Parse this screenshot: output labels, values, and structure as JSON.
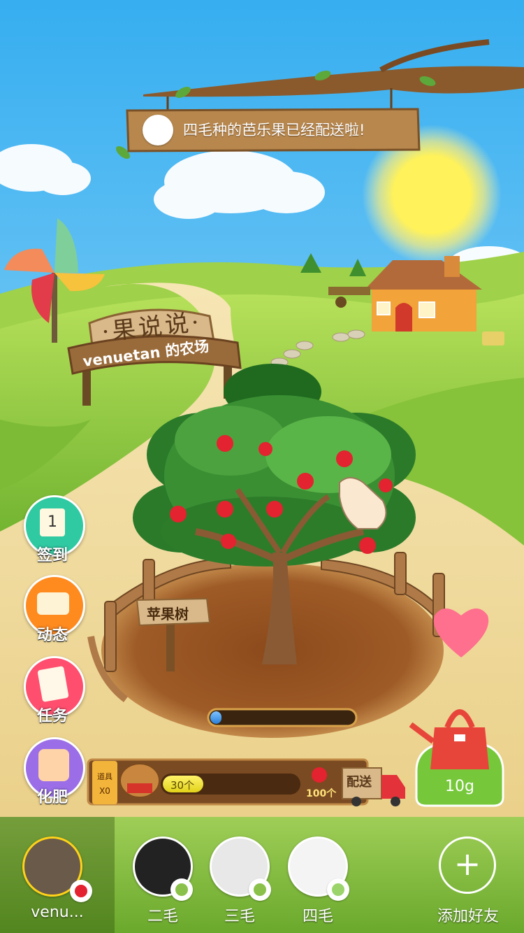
{
  "banner": {
    "message": "四毛种的芭乐果已经配送啦!"
  },
  "farm_sign": {
    "title": "·果说说·",
    "owner_line": "venuetan 的农场"
  },
  "tree": {
    "label": "苹果树",
    "growth_progress": 0.08
  },
  "side_buttons": [
    {
      "label": "签到",
      "icon": "calendar-icon",
      "color": "#2fc9a2"
    },
    {
      "label": "动态",
      "icon": "message-icon",
      "color": "#ff8a1e"
    },
    {
      "label": "任务",
      "icon": "task-list-icon",
      "color": "#ff4e6e"
    },
    {
      "label": "化肥",
      "icon": "fertilizer-bag-icon",
      "color": "#9b6ee8"
    }
  ],
  "props": {
    "title": "道具",
    "count": "X0"
  },
  "harvest": {
    "current_label": "30个",
    "target_label": "100个",
    "deliver_label": "配送",
    "fill_fraction": 0.3
  },
  "watering": {
    "amount": "10g"
  },
  "friends": [
    {
      "name": "venu...",
      "badge_icon": "apple-icon"
    },
    {
      "name": "二毛",
      "badge_icon": "guava-icon"
    },
    {
      "name": "三毛",
      "badge_icon": "guava-icon"
    },
    {
      "name": "四毛",
      "badge_icon": "guava-icon"
    }
  ],
  "add_friend": {
    "label": "添加好友",
    "icon": "plus-icon"
  },
  "colors": {
    "sky_top": "#3fb4ee",
    "grass": "#8cc63f",
    "soil": "#9a5a26",
    "wood": "#a87342",
    "heart": "#ff6f8e"
  }
}
